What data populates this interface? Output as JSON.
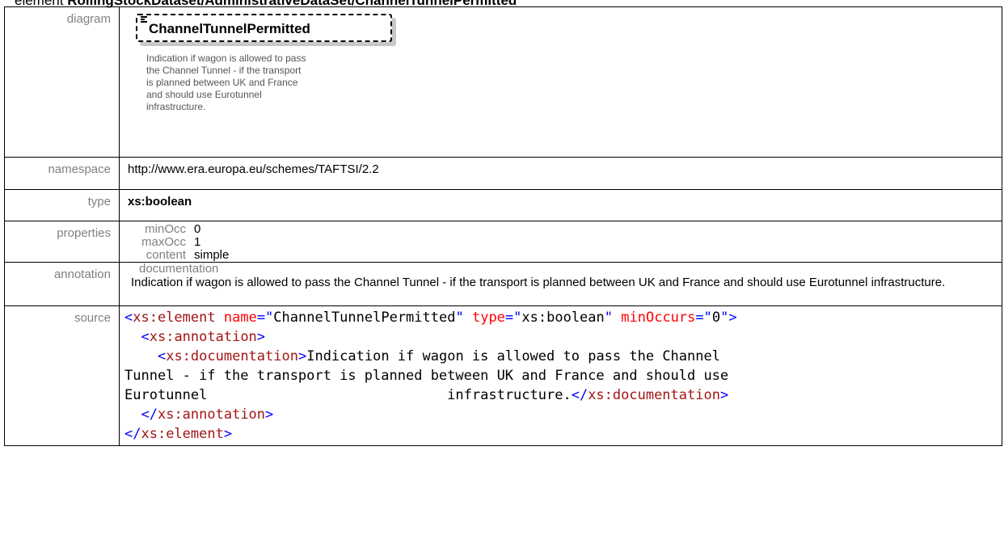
{
  "heading": {
    "prefix": "element",
    "path": "RollingStockDataset/AdministrativeDataSet/ChannelTunnelPermitted"
  },
  "labels": {
    "diagram": "diagram",
    "namespace": "namespace",
    "type": "type",
    "properties": "properties",
    "annotation": "annotation",
    "source": "source"
  },
  "diagram": {
    "element_name": "ChannelTunnelPermitted",
    "documentation": "Indication if wagon is allowed to pass the Channel Tunnel - if the transport is planned between UK and France and should use Eurotunnel infrastructure."
  },
  "namespace": "http://www.era.europa.eu/schemes/TAFTSI/2.2",
  "type": "xs:boolean",
  "properties": [
    {
      "key": "minOcc",
      "value": "0"
    },
    {
      "key": "maxOcc",
      "value": "1"
    },
    {
      "key": "content",
      "value": "simple"
    }
  ],
  "annotation": {
    "title": "documentation",
    "text": "Indication if wagon is allowed to pass the Channel Tunnel - if the transport is planned between UK and France and should use Eurotunnel infrastructure."
  },
  "source": {
    "element_open": "xs:element",
    "attr_name": "name",
    "val_name": "ChannelTunnelPermitted",
    "attr_type": "type",
    "val_type": "xs:boolean",
    "attr_min": "minOccurs",
    "val_min": "0",
    "annotation_tag": "xs:annotation",
    "documentation_tag": "xs:documentation",
    "doc_line1": "Indication if wagon is allowed to pass the Channel",
    "doc_line2": "Tunnel - if the transport is planned between UK and France and should use",
    "doc_line3a": "Eurotunnel",
    "doc_line3b": "infrastructure."
  },
  "colors": {
    "tag": "#a31515",
    "punct": "#0000ff",
    "attr": "#ff0000",
    "label": "#808080"
  },
  "icons": [
    "list-icon"
  ]
}
